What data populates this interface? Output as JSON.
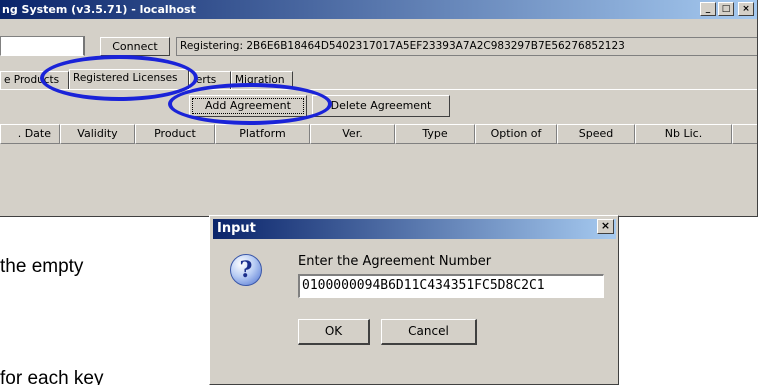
{
  "window": {
    "title": "ng System (v3.5.71) - localhost",
    "minimize_glyph": "_",
    "maximize_glyph": "□",
    "close_glyph": "×"
  },
  "toolbar": {
    "server_value": "",
    "connect_label": "Connect",
    "status_text": "Registering: 2B6E6B18464D5402317017A5EF23393A7A2C983297B7E56276852123"
  },
  "tabs": [
    {
      "label": "e Products"
    },
    {
      "label": "Registered Licenses"
    },
    {
      "label": "lerts"
    },
    {
      "label": "Migration"
    }
  ],
  "actions": {
    "add_label": "Add Agreement",
    "delete_label": "Delete Agreement"
  },
  "grid": {
    "columns": [
      "Date",
      "Validity",
      "Product",
      "Platform",
      "Ver.",
      "Type",
      "Option of",
      "Speed",
      "Nb Lic."
    ]
  },
  "background_text": {
    "line1": "the empty",
    "line2": "for each key"
  },
  "dialog": {
    "title": "Input",
    "close_glyph": "×",
    "icon_glyph": "?",
    "prompt": "Enter the Agreement Number",
    "input_value": "0100000094B6D11C434351FC5D8C2C1",
    "ok_label": "OK",
    "cancel_label": "Cancel"
  },
  "colors": {
    "annotation": "#1a23d8",
    "title_bar": "#0a246a",
    "face": "#d4d0c8"
  }
}
